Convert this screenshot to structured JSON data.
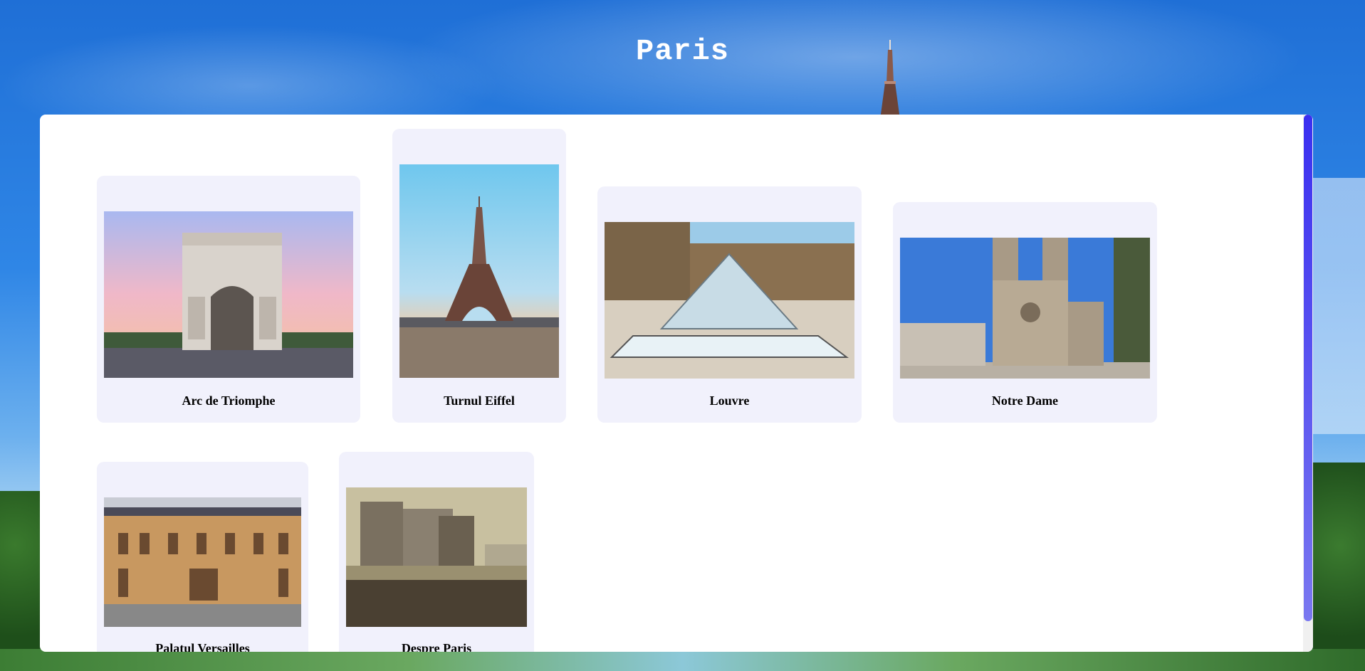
{
  "page": {
    "title": "Paris"
  },
  "attractions": [
    {
      "name": "Arc de Triomphe",
      "icon": "arc-de-triomphe-photo"
    },
    {
      "name": "Turnul Eiffel",
      "icon": "eiffel-tower-photo"
    },
    {
      "name": "Louvre",
      "icon": "louvre-photo"
    },
    {
      "name": "Notre Dame",
      "icon": "notre-dame-photo"
    },
    {
      "name": "Palatul Versailles",
      "icon": "versailles-palace-photo"
    },
    {
      "name": "Despre Paris",
      "icon": "bastille-painting-photo"
    }
  ],
  "colors": {
    "card_bg": "#f1f1fc",
    "scroll_thumb": "#3a2ff0",
    "sky": "#2f86e6"
  }
}
